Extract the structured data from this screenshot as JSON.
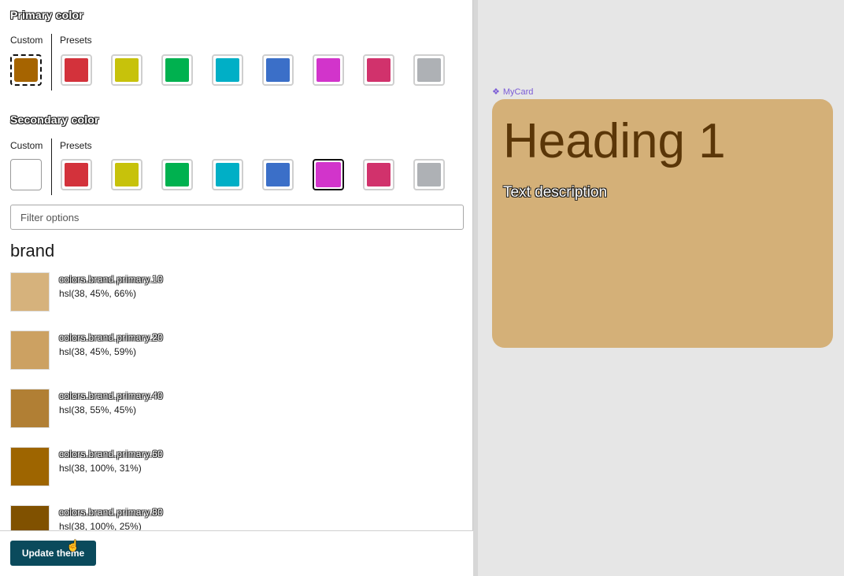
{
  "primary": {
    "title": "Primary color",
    "custom_label": "Custom",
    "presets_label": "Presets",
    "custom_color": "#a66400",
    "presets": [
      {
        "name": "red",
        "color": "#d3323b"
      },
      {
        "name": "yellow",
        "color": "#c7c20b"
      },
      {
        "name": "green",
        "color": "#00b14f"
      },
      {
        "name": "cyan",
        "color": "#00afc6"
      },
      {
        "name": "blue",
        "color": "#3b6fc8"
      },
      {
        "name": "magenta",
        "color": "#d234cb"
      },
      {
        "name": "pink",
        "color": "#d1326c"
      },
      {
        "name": "gray",
        "color": "#aeb1b5"
      }
    ]
  },
  "secondary": {
    "title": "Secondary color",
    "custom_label": "Custom",
    "presets_label": "Presets",
    "custom_color": "#ffffff",
    "selected_preset": "magenta",
    "presets": [
      {
        "name": "red",
        "color": "#d3323b"
      },
      {
        "name": "yellow",
        "color": "#c7c20b"
      },
      {
        "name": "green",
        "color": "#00b14f"
      },
      {
        "name": "cyan",
        "color": "#00afc6"
      },
      {
        "name": "blue",
        "color": "#3b6fc8"
      },
      {
        "name": "magenta",
        "color": "#d234cb"
      },
      {
        "name": "pink",
        "color": "#d1326c"
      },
      {
        "name": "gray",
        "color": "#aeb1b5"
      }
    ]
  },
  "filter": {
    "placeholder": "Filter options"
  },
  "token_group": {
    "heading": "brand",
    "tokens": [
      {
        "name": "colors.brand.primary.10",
        "value": "hsl(38, 45%, 66%)",
        "color": "#d6b27c"
      },
      {
        "name": "colors.brand.primary.20",
        "value": "hsl(38, 45%, 59%)",
        "color": "#cca162"
      },
      {
        "name": "colors.brand.primary.40",
        "value": "hsl(38, 55%, 45%)",
        "color": "#b17f34"
      },
      {
        "name": "colors.brand.primary.60",
        "value": "hsl(38, 100%, 31%)",
        "color": "#9e6500"
      },
      {
        "name": "colors.brand.primary.80",
        "value": "hsl(38, 100%, 25%)",
        "color": "#805100"
      }
    ]
  },
  "footer": {
    "update_label": "Update theme"
  },
  "preview": {
    "component_label": "MyCard",
    "card_heading": "Heading 1",
    "card_text": "Text description",
    "card_color": "#d4b078",
    "heading_color": "#5a3608",
    "accent_color": "#7b5cd6"
  }
}
